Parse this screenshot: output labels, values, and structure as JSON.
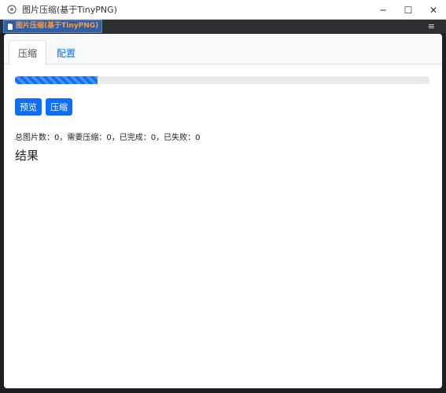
{
  "window": {
    "title": "图片压缩(基于TinyPNG)",
    "controls": {
      "minimize": "─",
      "maximize": "☐",
      "close": "✕"
    }
  },
  "toolstrip": {
    "tab_label": "图片压缩(基于TinyPNG)",
    "tab_icon": "document-icon",
    "menu_glyph": "≡"
  },
  "tabs": [
    {
      "label": "压缩",
      "active": true
    },
    {
      "label": "配置",
      "active": false
    }
  ],
  "progress": {
    "fraction": 0.2,
    "style": "striped",
    "color": "#0d6efd"
  },
  "buttons": {
    "preview": "预览",
    "compress": "压缩"
  },
  "stats": {
    "text": "总图片数：0，需要压缩：0，已完成：0，已失败：0"
  },
  "results": {
    "heading": "结果"
  },
  "colors": {
    "accent": "#0d6efd",
    "tab_text_highlight": "#ff9b3b"
  }
}
